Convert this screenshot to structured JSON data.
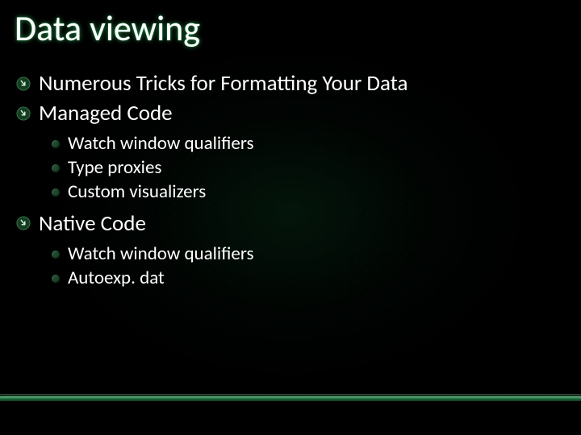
{
  "title": "Data viewing",
  "items": [
    {
      "level": 1,
      "text": "Numerous Tricks for Formatting Your Data"
    },
    {
      "level": 1,
      "text": "Managed Code"
    },
    {
      "level": 2,
      "text": "Watch window qualifiers"
    },
    {
      "level": 2,
      "text": "Type proxies"
    },
    {
      "level": 2,
      "text": "Custom visualizers"
    },
    {
      "level": 1,
      "text": "Native Code"
    },
    {
      "level": 2,
      "text": "Watch window qualifiers"
    },
    {
      "level": 2,
      "text": "Autoexp. dat"
    }
  ]
}
